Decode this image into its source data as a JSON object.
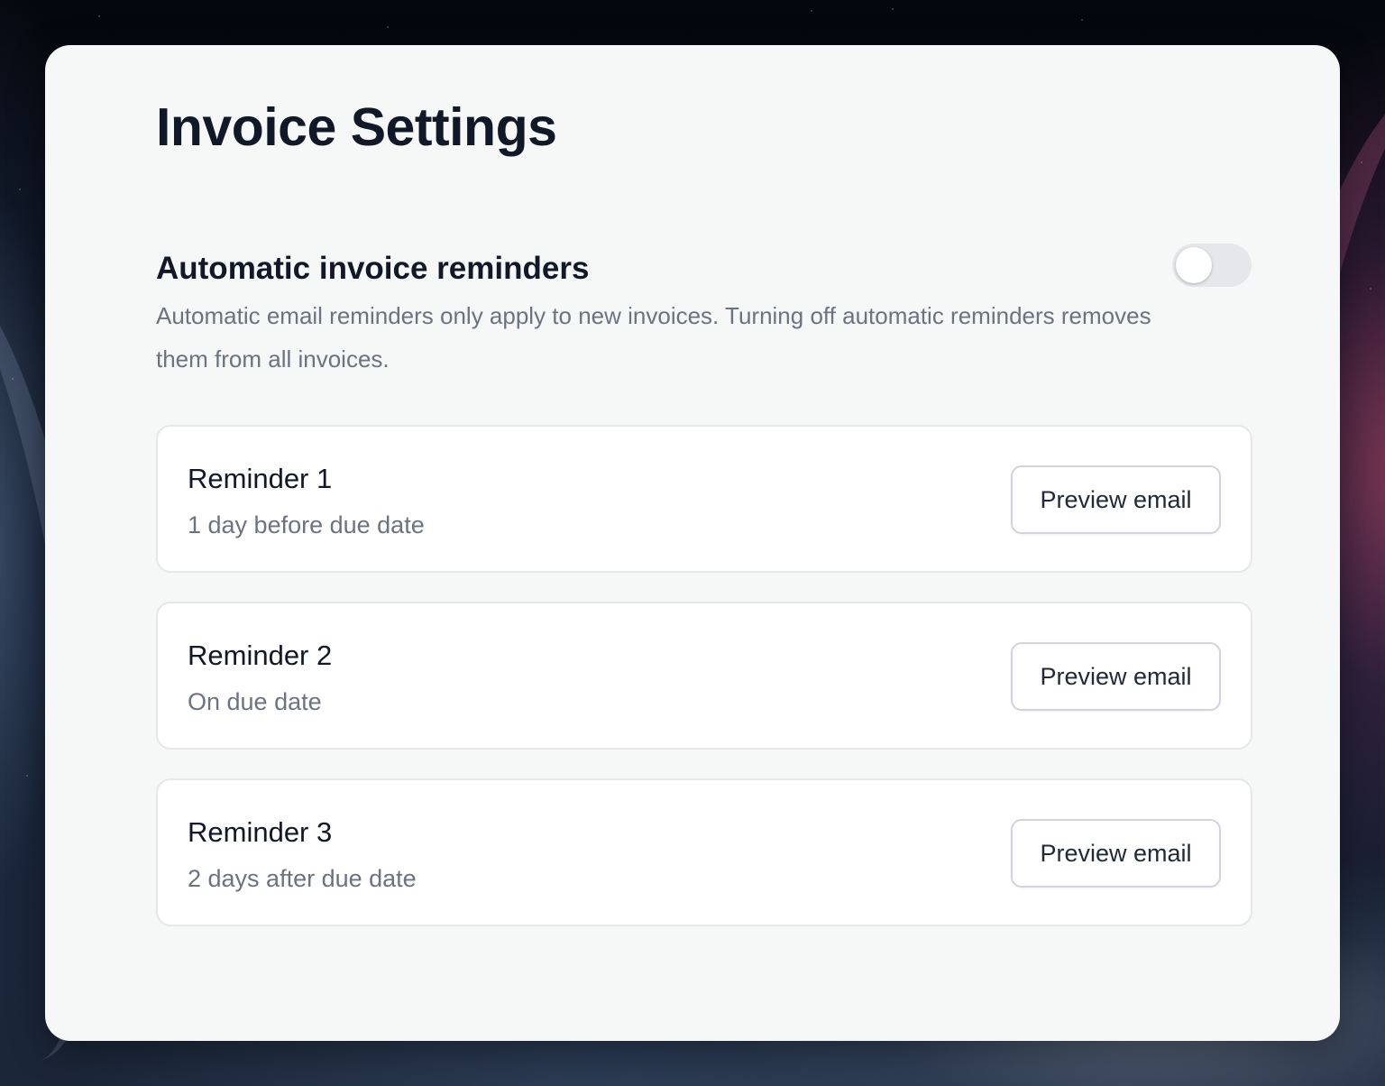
{
  "page": {
    "title": "Invoice Settings"
  },
  "reminders_section": {
    "title": "Automatic invoice reminders",
    "description": "Automatic email reminders only apply to new invoices. Turning off automatic reminders removes them from all invoices.",
    "toggle_on": false
  },
  "reminders": [
    {
      "title": "Reminder 1",
      "timing": "1 day before due date",
      "button_label": "Preview email"
    },
    {
      "title": "Reminder 2",
      "timing": "On due date",
      "button_label": "Preview email"
    },
    {
      "title": "Reminder 3",
      "timing": "2 days after due date",
      "button_label": "Preview email"
    }
  ],
  "colors": {
    "card_background": "#f6f8f7",
    "heading": "#111827",
    "muted_text": "#6b7280",
    "toggle_off": "#e5e7eb"
  }
}
